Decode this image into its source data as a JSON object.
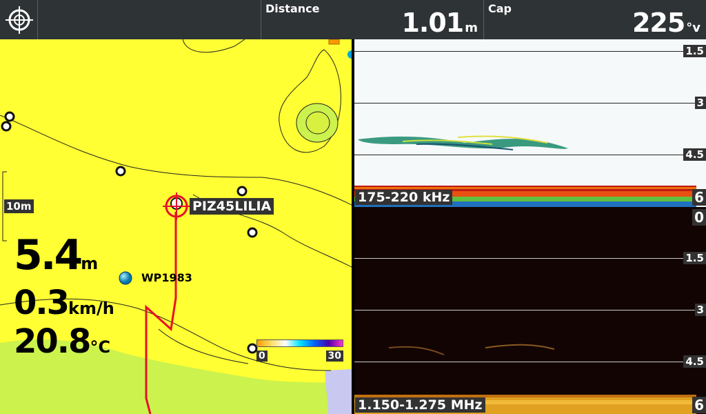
{
  "topbar": {
    "menu_icon": "crosshair-icon",
    "distance": {
      "label": "Distance",
      "value": "1.01",
      "unit": "m"
    },
    "cap": {
      "label": "Cap",
      "value": "225",
      "unit": "°v"
    }
  },
  "chart": {
    "scale_label": "10m",
    "target_label": "PIZ45LILIA",
    "waypoint_label": "WP1983",
    "depth": {
      "value": "5.4",
      "unit": "m"
    },
    "speed": {
      "value": "0.3",
      "unit": "km/h"
    },
    "temperature": {
      "value": "20.8",
      "unit": "°C"
    },
    "colorbar": {
      "min": "0",
      "max": "30"
    },
    "colors": {
      "land_yellow": "#ffff33",
      "shallow_green": "#ccf24d",
      "track_red": "#e8102a"
    }
  },
  "sonar_top": {
    "frequency": "175-220 kHz",
    "depth_marks": [
      "1.5",
      "3",
      "4.5",
      "6"
    ]
  },
  "sonar_bottom": {
    "frequency": "1.150-1.275 MHz",
    "depth_marks": [
      "0",
      "1.5",
      "3",
      "4.5",
      "6"
    ]
  }
}
